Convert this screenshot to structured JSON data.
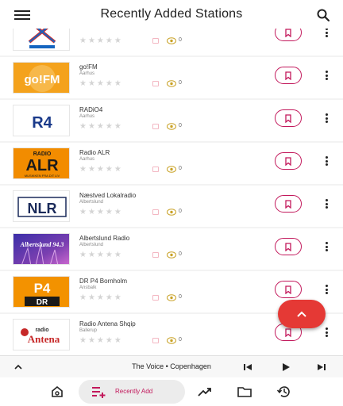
{
  "header": {
    "title": "Recently Added Stations"
  },
  "stations": [
    {
      "name": "",
      "city": "",
      "views": "0"
    },
    {
      "name": "go!FM",
      "city": "Aarhus",
      "views": "0"
    },
    {
      "name": "RADiO4",
      "city": "Aarhus",
      "views": "0"
    },
    {
      "name": "Radio ALR",
      "city": "Aarhus",
      "views": "0"
    },
    {
      "name": "Næstved Lokalradio",
      "city": "Albertslund",
      "views": "0"
    },
    {
      "name": "Albertslund Radio",
      "city": "Albertslund",
      "views": "0"
    },
    {
      "name": "DR P4 Bornholm",
      "city": "Ansbalk",
      "views": "0"
    },
    {
      "name": "Radio Antena Shqip",
      "city": "Ballerup",
      "views": "0"
    }
  ],
  "logos": {
    "gofm": "go!FM",
    "r4": "R4",
    "alr_top": "RADIO",
    "alr_main": "ALR",
    "alr_sub": "MUSIKKEN FRA DIT LIV",
    "nlr": "NLR",
    "alb": "Albertslund 94.3",
    "p4": "P4",
    "dr": "DR",
    "antena_small": "radio",
    "antena_main": "Antena"
  },
  "rating": {
    "stars": "★★★★★"
  },
  "player": {
    "now_playing": "The Voice • Copenhagen"
  },
  "bottom_nav": {
    "recently_added": "Recently Add"
  },
  "colors": {
    "accent": "#c2185b",
    "fab": "#e53935",
    "gofm": "#f4a21c",
    "r4_blue": "#1a3a8a",
    "p4_orange": "#f39200"
  }
}
